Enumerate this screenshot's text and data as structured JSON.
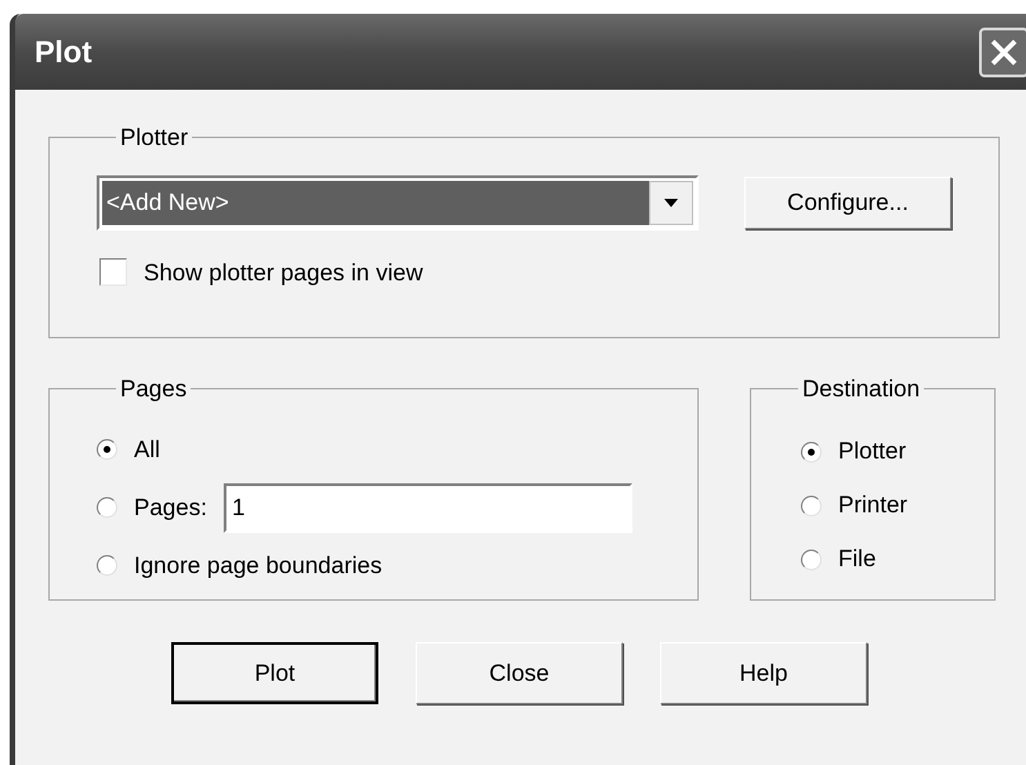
{
  "window": {
    "title": "Plot"
  },
  "plotter": {
    "label": "Plotter",
    "combo": {
      "value": "<Add New>",
      "highlighted": true
    },
    "configure_button": "Configure...",
    "show_pages": {
      "label": "Show plotter pages in view",
      "checked": false
    }
  },
  "pages": {
    "label": "Pages",
    "options": [
      {
        "kind": "plain",
        "label": "All",
        "selected": true
      },
      {
        "kind": "field",
        "label": "Pages:",
        "value": "1",
        "selected": false
      },
      {
        "kind": "plain",
        "label": "Ignore page boundaries",
        "selected": false
      }
    ]
  },
  "destination": {
    "label": "Destination",
    "options": [
      {
        "label": "Plotter",
        "selected": true
      },
      {
        "label": "Printer",
        "selected": false
      },
      {
        "label": "File",
        "selected": false
      }
    ]
  },
  "buttons": [
    {
      "label": "Plot",
      "default": true
    },
    {
      "label": "Close",
      "default": false
    },
    {
      "label": "Help",
      "default": false
    }
  ]
}
